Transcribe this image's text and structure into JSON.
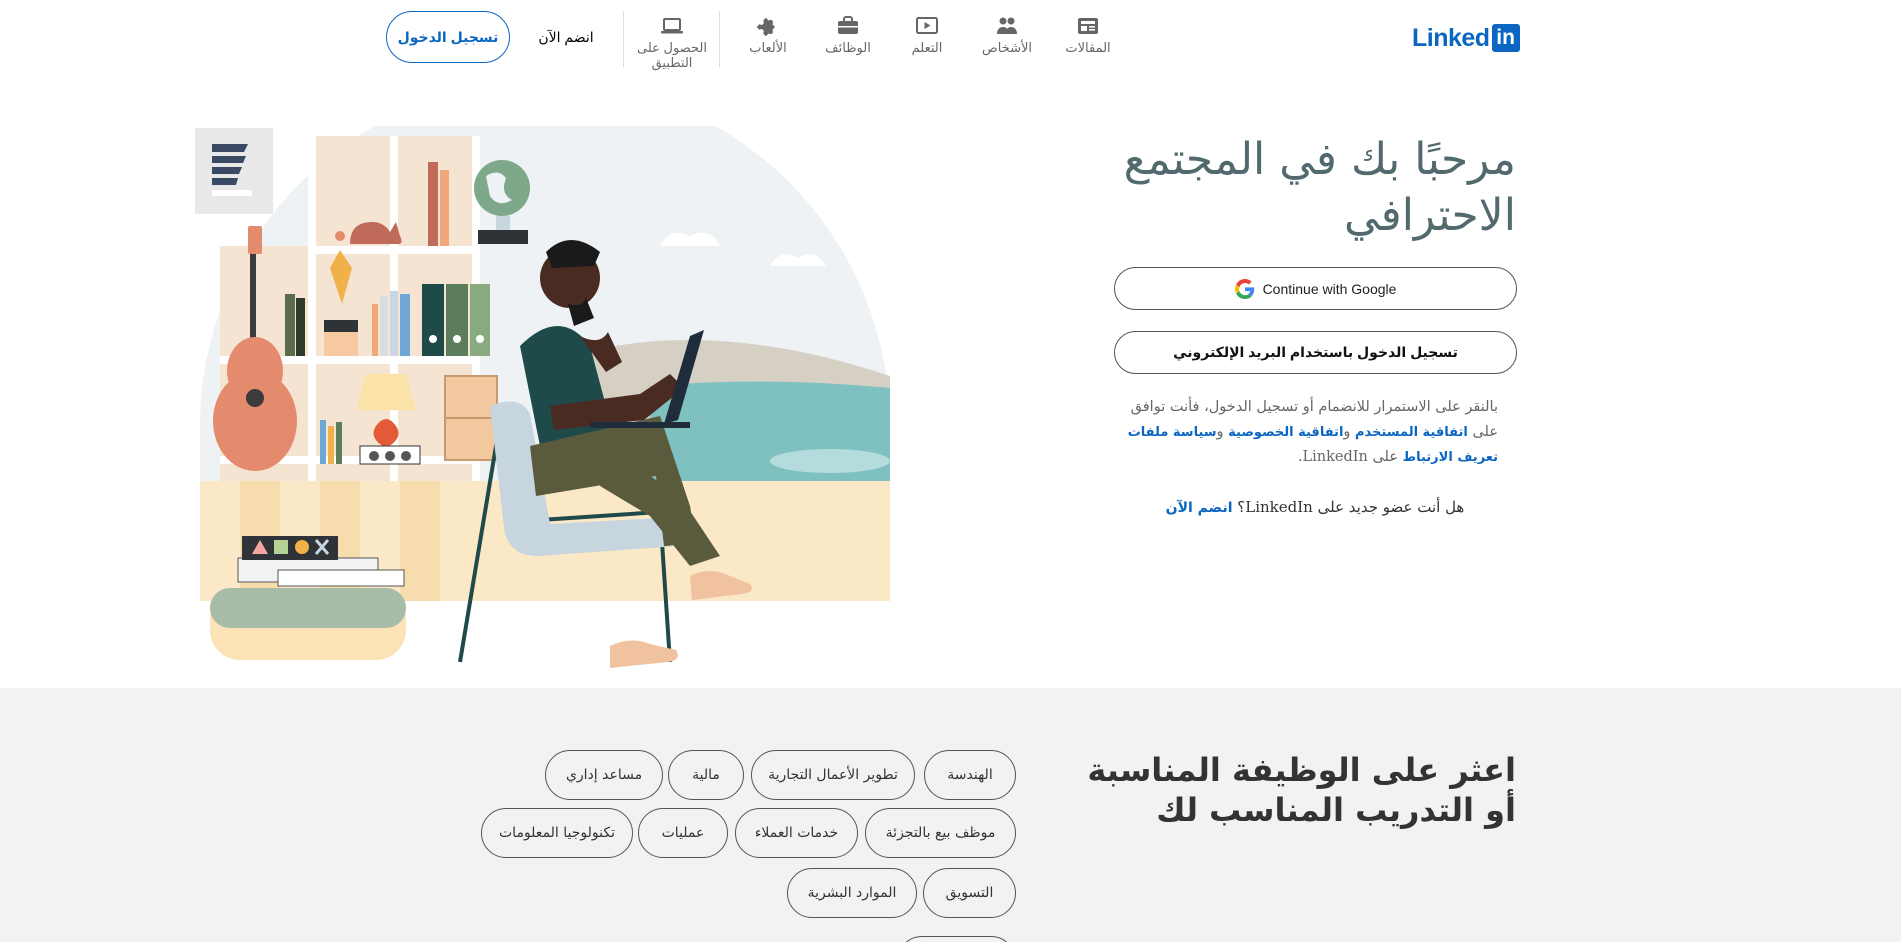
{
  "brand": {
    "word": "Linked",
    "box": "in",
    "color": "#0a66c2"
  },
  "nav": {
    "items": [
      {
        "label": "المقالات",
        "icon": "articles-icon"
      },
      {
        "label": "الأشخاص",
        "icon": "people-icon"
      },
      {
        "label": "التعلم",
        "icon": "learning-icon"
      },
      {
        "label": "الوظائف",
        "icon": "briefcase-icon"
      },
      {
        "label": "الألعاب",
        "icon": "puzzle-icon"
      },
      {
        "label": "الحصول على التطبيق",
        "icon": "laptop-icon"
      }
    ],
    "join_label": "انضم الآن",
    "signin_label": "تسجيل الدخول"
  },
  "hero": {
    "title": "مرحبًا بك في المجتمع الاحترافي",
    "google_button": "Continue with Google",
    "email_button": "تسجيل الدخول باستخدام البريد الإلكتروني",
    "legal": {
      "prefix": "بالنقر على الاستمرار للانضمام أو تسجيل الدخول، فأنت توافق على",
      "user_agreement": "اتفاقية المستخدم",
      "privacy_policy": "اتفاقية الخصوصية",
      "cookie_policy": "سياسة ملفات تعريف الارتباط",
      "and": "و",
      "on": "على",
      "suffix": "LinkedIn."
    },
    "new_member": {
      "question": "هل أنت عضو جديد على LinkedIn؟",
      "join_link": "انضم الآن"
    }
  },
  "jobs": {
    "title": "اعثر على الوظيفة المناسبة أو التدريب المناسب لك",
    "chips": [
      "الهندسة",
      "تطوير الأعمال التجارية",
      "مالية",
      "مساعد إداري",
      "موظف بيع بالتجزئة",
      "خدمات العملاء",
      "عمليات",
      "تكنولوجيا المعلومات",
      "التسويق",
      "الموارد البشرية"
    ]
  },
  "colors": {
    "accent": "#0a66c2",
    "hero_title": "#526a6e",
    "lower_bg": "#f3f2f0"
  }
}
